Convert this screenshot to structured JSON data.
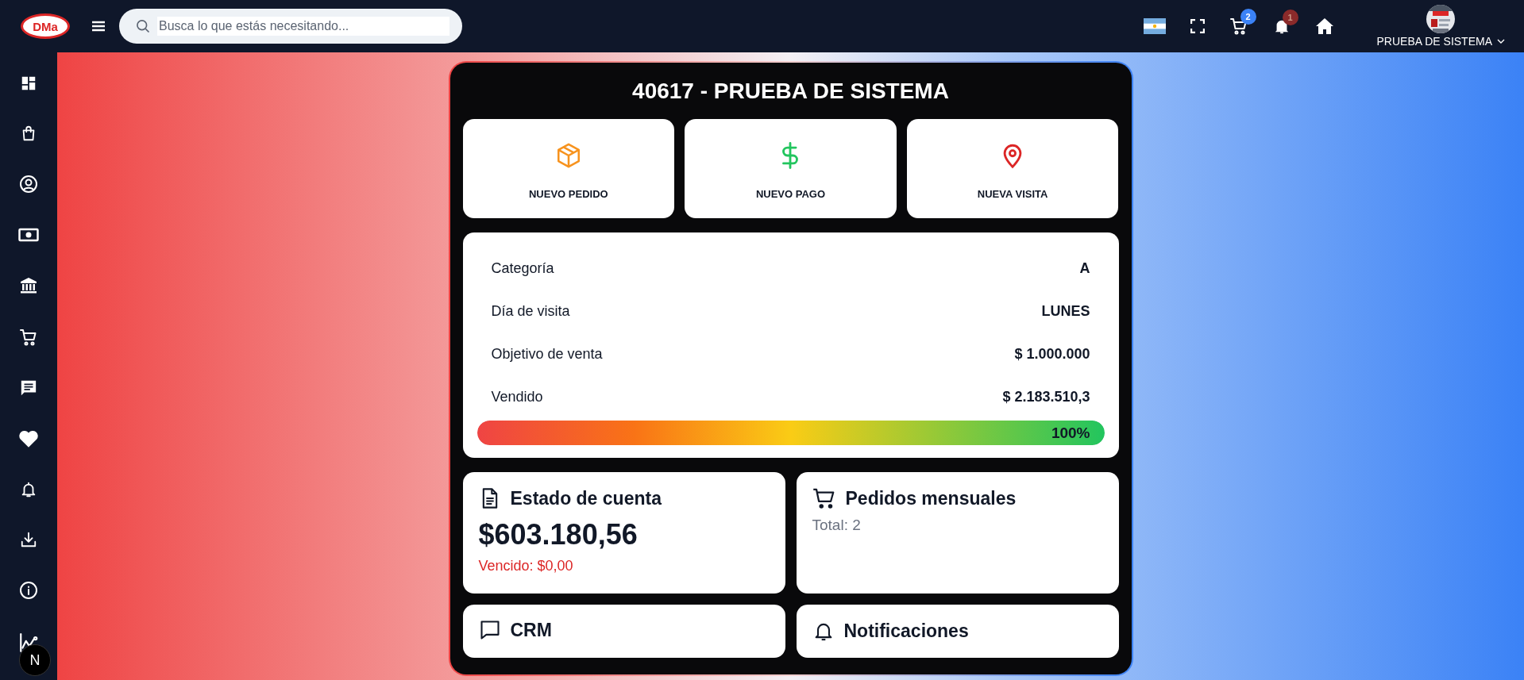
{
  "header": {
    "logo_text": "DMa",
    "search": {
      "placeholder": "Busca lo que estás necesitando..."
    },
    "cart_badge": "2",
    "notification_badge": "1",
    "user_name": "PRUEBA DE SISTEMA"
  },
  "dev_badge": "N",
  "panel": {
    "title": "40617 - PRUEBA DE SISTEMA",
    "actions": [
      {
        "kind": "order",
        "label": "NUEVO PEDIDO"
      },
      {
        "kind": "payment",
        "label": "NUEVO PAGO"
      },
      {
        "kind": "visit",
        "label": "NUEVA VISITA"
      }
    ],
    "details": [
      {
        "label": "Categoría",
        "value": "A"
      },
      {
        "label": "Día de visita",
        "value": "LUNES"
      },
      {
        "label": "Objetivo de venta",
        "value": "$ 1.000.000"
      },
      {
        "label": "Vendido",
        "value": "$ 2.183.510,3"
      }
    ],
    "progress": {
      "level": 1,
      "reading": "100%"
    },
    "cards": [
      {
        "kind": "account",
        "title": "Estado de cuenta",
        "amount": "$603.180,56",
        "overdue": "Vencido: $0,00"
      },
      {
        "kind": "orders",
        "title": "Pedidos mensuales",
        "note": "Total: 2"
      },
      {
        "kind": "crm",
        "title": "CRM"
      },
      {
        "kind": "notifications",
        "title": "Notificaciones"
      }
    ]
  }
}
